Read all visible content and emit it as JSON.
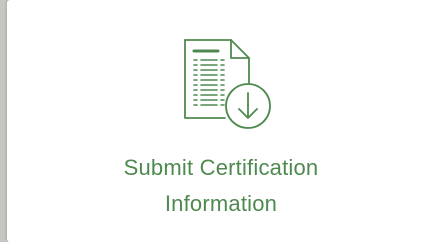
{
  "card": {
    "title_line1": "Submit Certification",
    "title_line2": "Information",
    "icon": "document-download-icon",
    "accent_color": "#4e8a4f"
  }
}
